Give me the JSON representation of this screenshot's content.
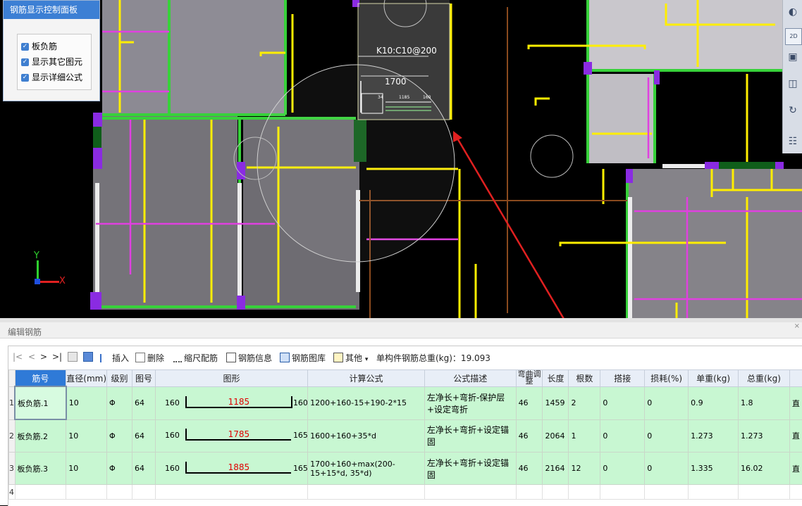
{
  "control_panel": {
    "title": "钢筋显示控制面板",
    "options": [
      {
        "label": "板负筋",
        "checked": true
      },
      {
        "label": "显示其它图元",
        "checked": true
      },
      {
        "label": "显示详细公式",
        "checked": true
      }
    ]
  },
  "canvas": {
    "axis_y": "Y",
    "axis_x": "X",
    "rebar_label": "K10:C10@200",
    "dimension": "1700",
    "mini_left": "34",
    "mini_mid": "1185",
    "mini_right": "160"
  },
  "view_toolbar": {
    "mode_label": "2D",
    "icons": [
      "sphere-icon",
      "2d-view-icon",
      "3d-box-icon",
      "cube-icon",
      "rotate-icon",
      "layers-icon"
    ]
  },
  "editor": {
    "title": "编辑钢筋",
    "close": "×",
    "nav": {
      "first": "|<",
      "prev": "<",
      "next": ">",
      "last": ">|"
    },
    "toolbar": {
      "insert": "插入",
      "delete": "删除",
      "scale": "缩尺配筋",
      "info": "钢筋信息",
      "library": "钢筋图库",
      "other": "其他",
      "other_caret": "▾",
      "total_label": "单构件钢筋总重(kg)：19.093"
    },
    "columns": [
      "筋号",
      "直径(mm)",
      "级别",
      "图号",
      "图形",
      "计算公式",
      "公式描述",
      "弯曲调整",
      "长度",
      "根数",
      "搭接",
      "损耗(%)",
      "单重(kg)",
      "总重(kg)"
    ],
    "rows": [
      {
        "index": "1",
        "name": "板负筋.1",
        "diameter": "10",
        "grade": "Φ",
        "figure_no": "64",
        "shape_left": "160",
        "shape_mid": "1185",
        "shape_right": "160",
        "formula": "1200+160-15+190-2*15",
        "desc": "左净长+弯折-保护层+设定弯折",
        "bend": "46",
        "length": "1459",
        "count": "2",
        "lap": "0",
        "loss": "0",
        "unit_weight": "0.9",
        "total_weight": "1.8",
        "extra": "直"
      },
      {
        "index": "2",
        "name": "板负筋.2",
        "diameter": "10",
        "grade": "Φ",
        "figure_no": "64",
        "shape_left": "160",
        "shape_mid": "1785",
        "shape_right": "165",
        "formula": "1600+160+35*d",
        "desc": "左净长+弯折+设定锚固",
        "bend": "46",
        "length": "2064",
        "count": "1",
        "lap": "0",
        "loss": "0",
        "unit_weight": "1.273",
        "total_weight": "1.273",
        "extra": "直"
      },
      {
        "index": "3",
        "name": "板负筋.3",
        "diameter": "10",
        "grade": "Φ",
        "figure_no": "64",
        "shape_left": "160",
        "shape_mid": "1885",
        "shape_right": "165",
        "formula": "1700+160+max(200-15+15*d, 35*d)",
        "desc": "左净长+弯折+设定锚固",
        "bend": "46",
        "length": "2164",
        "count": "12",
        "lap": "0",
        "loss": "0",
        "unit_weight": "1.335",
        "total_weight": "16.02",
        "extra": "直"
      }
    ],
    "empty_row_index": "4"
  },
  "colors": {
    "accent": "#3c7fd4",
    "row_fill": "#c8f7d2",
    "header_fill": "#e8eef7",
    "red_annotation": "#e02020"
  }
}
